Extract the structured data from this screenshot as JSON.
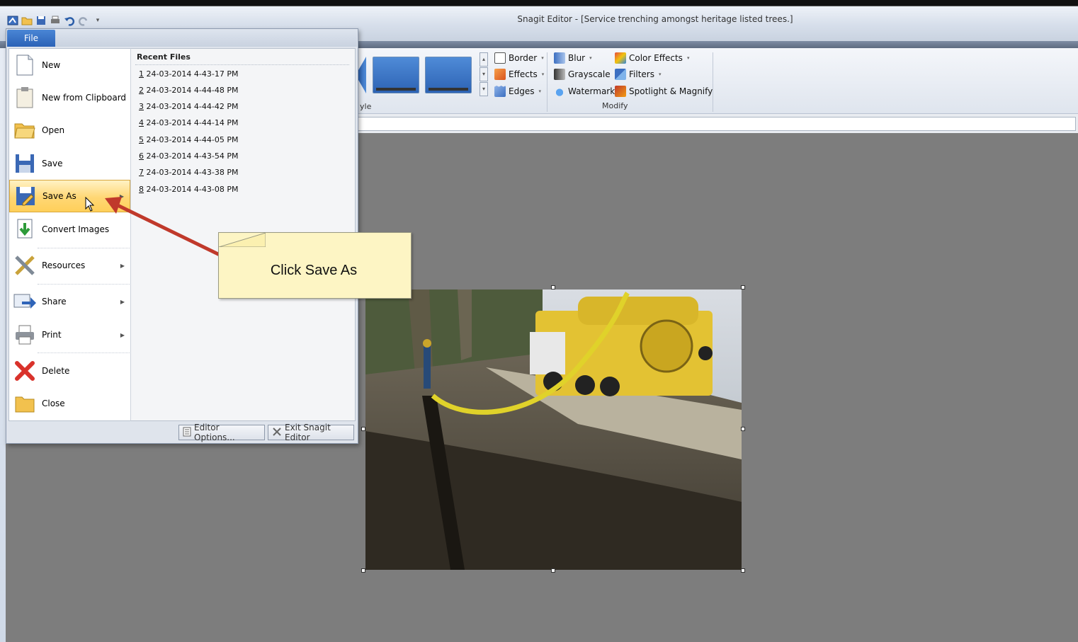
{
  "window": {
    "title": "Snagit Editor - [Service trenching amongst heritage listed trees.]"
  },
  "file_menu": {
    "tab_label": "File",
    "commands": [
      {
        "label": "New",
        "icon": "new-document-icon",
        "submenu": false
      },
      {
        "label": "New from Clipboard",
        "icon": "clipboard-icon",
        "submenu": false
      },
      {
        "label": "Open",
        "icon": "folder-open-icon",
        "submenu": false
      },
      {
        "label": "Save",
        "icon": "save-icon",
        "submenu": false
      },
      {
        "label": "Save As",
        "icon": "save-as-icon",
        "submenu": true,
        "selected": true
      },
      {
        "label": "Convert Images",
        "icon": "convert-images-icon",
        "submenu": false
      },
      {
        "label": "Resources",
        "icon": "resources-icon",
        "submenu": true
      },
      {
        "label": "Share",
        "icon": "share-icon",
        "submenu": true
      },
      {
        "label": "Print",
        "icon": "print-icon",
        "submenu": true
      },
      {
        "label": "Delete",
        "icon": "delete-icon",
        "submenu": false
      },
      {
        "label": "Close",
        "icon": "close-folder-icon",
        "submenu": false
      }
    ],
    "recent": {
      "title": "Recent Files",
      "items": [
        {
          "num": "1",
          "text": " 24-03-2014 4-43-17 PM"
        },
        {
          "num": "2",
          "text": " 24-03-2014 4-44-48 PM"
        },
        {
          "num": "3",
          "text": " 24-03-2014 4-44-42 PM"
        },
        {
          "num": "4",
          "text": " 24-03-2014 4-44-14 PM"
        },
        {
          "num": "5",
          "text": " 24-03-2014 4-44-05 PM"
        },
        {
          "num": "6",
          "text": " 24-03-2014 4-43-54 PM"
        },
        {
          "num": "7",
          "text": " 24-03-2014 4-43-38 PM"
        },
        {
          "num": "8",
          "text": " 24-03-2014 4-43-08 PM"
        }
      ]
    },
    "footer": {
      "editor_options": "Editor Options...",
      "exit": "Exit Snagit Editor"
    }
  },
  "ribbon": {
    "style_group_label": "yle",
    "style_items": [
      "Border",
      "Effects",
      "Edges"
    ],
    "modify_items": [
      "Blur",
      "Grayscale",
      "Watermark",
      "Color Effects",
      "Filters",
      "Spotlight & Magnify"
    ],
    "modify_group_label": "Modify"
  },
  "callout": {
    "text": "Click Save As"
  },
  "colors": {
    "accent": "#2b62b7",
    "selection": "#ffd774",
    "callout_fill": "#fdf5c4",
    "arrow": "#c0392b",
    "canvas": "#7d7d7d"
  }
}
